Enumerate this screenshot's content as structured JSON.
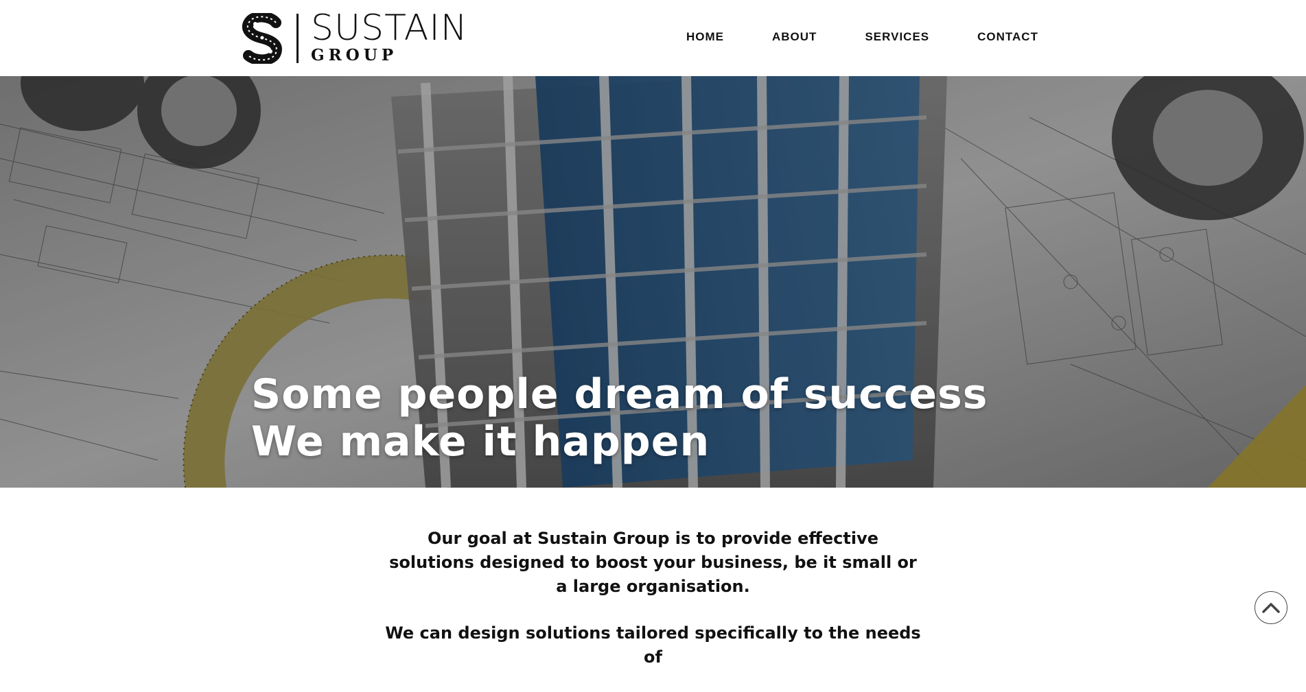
{
  "brand": {
    "name": "SUSTAIN",
    "subtitle": "GROUP"
  },
  "nav": {
    "items": [
      {
        "label": "HOME"
      },
      {
        "label": "ABOUT"
      },
      {
        "label": "SERVICES"
      },
      {
        "label": "CONTACT"
      }
    ]
  },
  "hero": {
    "line1": "Some people dream of success",
    "line2": "We make it happen"
  },
  "intro": {
    "paragraph1": "Our goal at Sustain Group is to provide effective solutions designed to boost your business, be it small or a large organisation.",
    "paragraph2": "We can design solutions tailored specifically to the needs of"
  },
  "icons": {
    "back_to_top": "chevron-up-icon"
  },
  "colors": {
    "accent_blue": "#2c5a86",
    "text": "#111111",
    "background": "#ffffff"
  }
}
